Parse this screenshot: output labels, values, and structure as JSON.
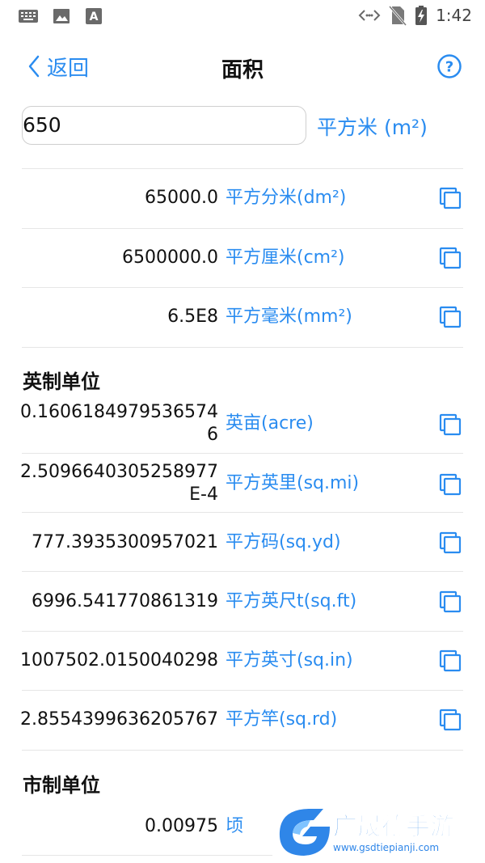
{
  "status_bar": {
    "time": "1:42"
  },
  "nav": {
    "back_label": "返回",
    "title": "面积"
  },
  "input": {
    "value": "650",
    "unit": "平方米 (m²)"
  },
  "metric_rows": [
    {
      "value": "65000.0",
      "unit": "平方分米(dm²)"
    },
    {
      "value": "6500000.0",
      "unit": "平方厘米(cm²)"
    },
    {
      "value": "6.5E8",
      "unit": "平方毫米(mm²)"
    }
  ],
  "imperial": {
    "title": "英制单位",
    "rows": [
      {
        "value_line1": "0.1606184979536574",
        "value_line2": "6",
        "unit": "英亩(acre)"
      },
      {
        "value_line1": "2.5096640305258977",
        "value_line2": "E-4",
        "unit": "平方英里(sq.mi)"
      },
      {
        "value": "777.3935300957021",
        "unit": "平方码(sq.yd)"
      },
      {
        "value": "6996.541770861319",
        "unit": "平方英尺t(sq.ft)"
      },
      {
        "value": "1007502.0150040298",
        "unit": "平方英寸(sq.in)"
      },
      {
        "value": "2.8554399636205767",
        "unit": "平方竿(sq.rd)"
      }
    ]
  },
  "chinese": {
    "title": "市制单位",
    "rows": [
      {
        "value": "0.00975",
        "unit": "顷"
      }
    ]
  },
  "watermark": {
    "brand": "广晟德手游",
    "url": "www.gsdtiepianji.com"
  },
  "colors": {
    "accent": "#2a8cf0",
    "divider": "#e6e6e6"
  }
}
